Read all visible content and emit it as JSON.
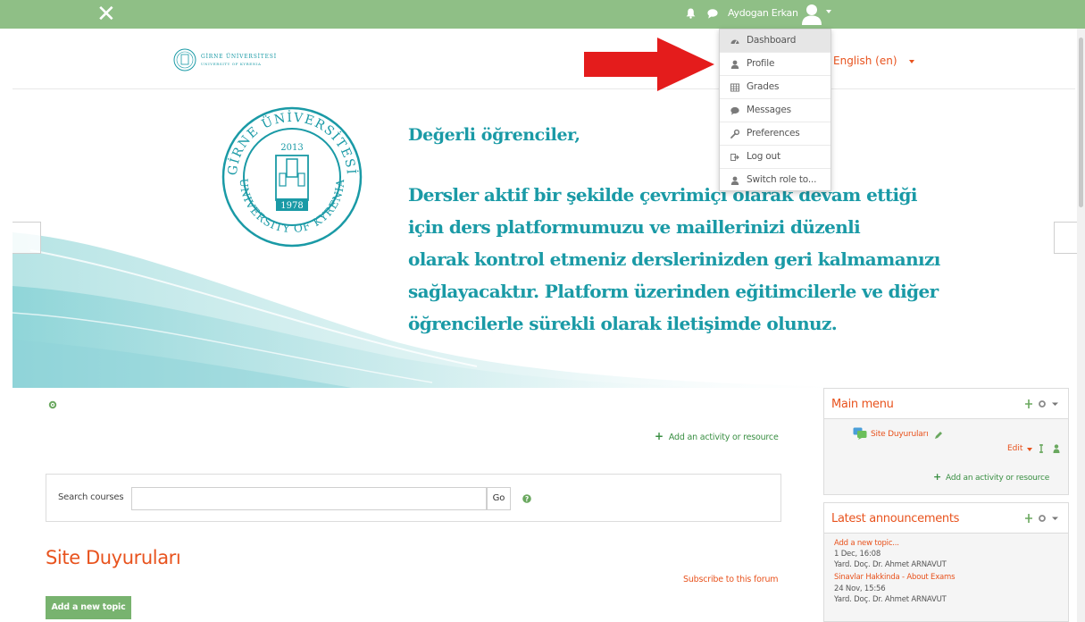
{
  "topbar": {
    "close_glyph": "✕",
    "user_name": "Aydogan Erkan",
    "icons": [
      "close-icon",
      "bell-icon",
      "chat-icon",
      "user-avatar-icon"
    ]
  },
  "header": {
    "logo_line1": "GİRNE ÜNİVERSİTESİ",
    "logo_line2": "UNIVERSITY OF KYRENIA",
    "language": "English (en)"
  },
  "banner": {
    "seal_top": "GİRNE ÜNİVERSİTESİ",
    "seal_bottom": "UNIVERSITY OF KYRENIA",
    "seal_year_top": "2013",
    "seal_year_bottom": "1978",
    "greeting": "Değerli öğrenciler,",
    "lines": [
      "Dersler aktif bir şekilde çevrimiçi olarak devam ettiği",
      "için ders platformumuzu ve maillerinizi düzenli",
      "olarak kontrol etmeniz derslerinizden geri kalmamanızı",
      "sağlayacaktır. Platform üzerinden eğitimcilerle ve diğer",
      "öğrencilerle sürekli olarak iletişimde olunuz."
    ]
  },
  "user_menu": {
    "items": [
      {
        "label": "Dashboard",
        "icon": "dashboard-icon"
      },
      {
        "label": "Profile",
        "icon": "user-icon"
      },
      {
        "label": "Grades",
        "icon": "table-icon"
      },
      {
        "label": "Messages",
        "icon": "chat-icon"
      },
      {
        "label": "Preferences",
        "icon": "wrench-icon"
      },
      {
        "label": "Log out",
        "icon": "logout-icon"
      },
      {
        "label": "Switch role to...",
        "icon": "user-icon"
      }
    ]
  },
  "main": {
    "add_activity": "Add an activity or resource",
    "search_label": "Search courses",
    "search_value": "",
    "go_label": "Go",
    "forum_title": "Site Duyuruları",
    "subscribe": "Subscribe to this forum",
    "new_topic": "Add a new topic"
  },
  "main_menu_block": {
    "title": "Main menu",
    "item_label": "Site Duyuruları",
    "edit_label": "Edit",
    "add_activity": "Add an activity or resource"
  },
  "news_block": {
    "title": "Latest announcements",
    "entries": [
      {
        "link": "Add a new topic...",
        "date": "1 Dec, 16:08",
        "author": "Yard. Doç. Dr. Ahmet ARNAVUT"
      },
      {
        "link": "Sinavlar Hakkinda - About Exams",
        "date": "24 Nov, 15:56",
        "author": "Yard. Doç. Dr. Ahmet ARNAVUT"
      }
    ]
  },
  "colors": {
    "topbar": "#8fbf86",
    "accent_orange": "#e8531e",
    "accent_green": "#3a8f43",
    "banner_text": "#1a9aa6",
    "button_green": "#78b36f",
    "arrow_red": "#e41c1c"
  }
}
